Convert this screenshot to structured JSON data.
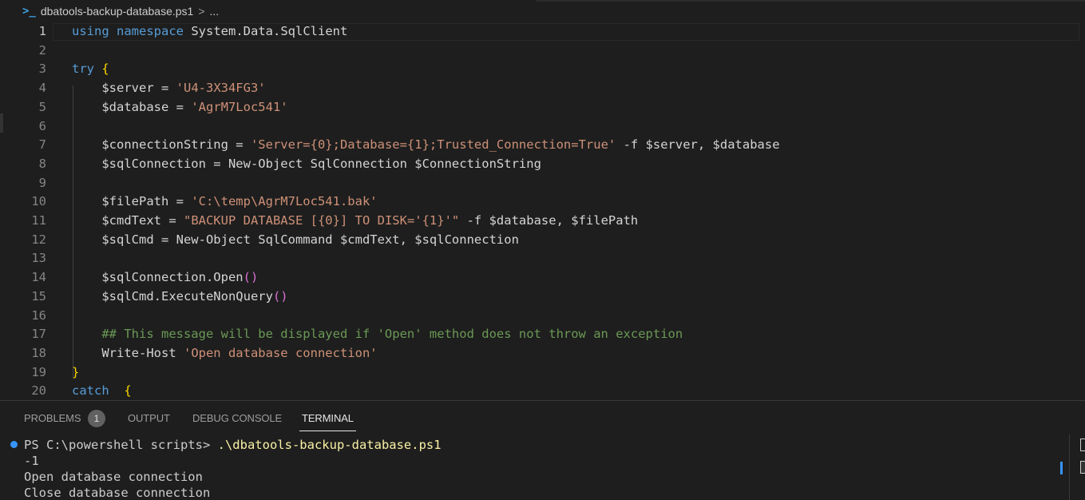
{
  "breadcrumb": {
    "icon": "powershell-icon",
    "filename": "dbatools-backup-database.ps1",
    "separator": ">",
    "more": "..."
  },
  "editor": {
    "lines": [
      {
        "num": "1",
        "tokens": [
          {
            "t": "kw",
            "v": "using"
          },
          {
            "t": "p",
            "v": " "
          },
          {
            "t": "kw",
            "v": "namespace"
          },
          {
            "t": "p",
            "v": " System.Data.SqlClient"
          }
        ]
      },
      {
        "num": "2",
        "tokens": []
      },
      {
        "num": "3",
        "tokens": [
          {
            "t": "kw",
            "v": "try"
          },
          {
            "t": "p",
            "v": " "
          },
          {
            "t": "brace",
            "v": "{"
          }
        ]
      },
      {
        "num": "4",
        "tokens": [
          {
            "t": "p",
            "v": "    $server = "
          },
          {
            "t": "str",
            "v": "'U4-3X34FG3'"
          }
        ]
      },
      {
        "num": "5",
        "tokens": [
          {
            "t": "p",
            "v": "    $database = "
          },
          {
            "t": "str",
            "v": "'AgrM7Loc541'"
          }
        ]
      },
      {
        "num": "6",
        "tokens": []
      },
      {
        "num": "7",
        "tokens": [
          {
            "t": "p",
            "v": "    $connectionString = "
          },
          {
            "t": "str",
            "v": "'Server={0};Database={1};Trusted_Connection=True'"
          },
          {
            "t": "p",
            "v": " -f $server, $database"
          }
        ]
      },
      {
        "num": "8",
        "tokens": [
          {
            "t": "p",
            "v": "    $sqlConnection = New-Object SqlConnection $ConnectionString"
          }
        ]
      },
      {
        "num": "9",
        "tokens": []
      },
      {
        "num": "10",
        "tokens": [
          {
            "t": "p",
            "v": "    $filePath = "
          },
          {
            "t": "str",
            "v": "'C:\\temp\\AgrM7Loc541.bak'"
          }
        ]
      },
      {
        "num": "11",
        "tokens": [
          {
            "t": "p",
            "v": "    $cmdText = "
          },
          {
            "t": "str",
            "v": "\"BACKUP DATABASE [{0}] TO DISK='{1}'\""
          },
          {
            "t": "p",
            "v": " -f $database, $filePath"
          }
        ]
      },
      {
        "num": "12",
        "tokens": [
          {
            "t": "p",
            "v": "    $sqlCmd = New-Object SqlCommand $cmdText, $sqlConnection"
          }
        ]
      },
      {
        "num": "13",
        "tokens": []
      },
      {
        "num": "14",
        "tokens": [
          {
            "t": "p",
            "v": "    $sqlConnection.Open"
          },
          {
            "t": "paren",
            "v": "()"
          }
        ]
      },
      {
        "num": "15",
        "tokens": [
          {
            "t": "p",
            "v": "    $sqlCmd.ExecuteNonQuery"
          },
          {
            "t": "paren",
            "v": "()"
          }
        ]
      },
      {
        "num": "16",
        "tokens": []
      },
      {
        "num": "17",
        "tokens": [
          {
            "t": "cmt",
            "v": "    ## This message will be displayed if 'Open' method does not throw an exception"
          }
        ]
      },
      {
        "num": "18",
        "tokens": [
          {
            "t": "p",
            "v": "    Write-Host "
          },
          {
            "t": "str",
            "v": "'Open database connection'"
          }
        ]
      },
      {
        "num": "19",
        "tokens": [
          {
            "t": "brace",
            "v": "}"
          }
        ]
      },
      {
        "num": "20",
        "tokens": [
          {
            "t": "kw",
            "v": "catch"
          },
          {
            "t": "p",
            "v": "  "
          },
          {
            "t": "brace",
            "v": "{"
          }
        ]
      }
    ]
  },
  "panel": {
    "tabs": [
      {
        "label": "PROBLEMS",
        "active": false
      },
      {
        "label": "OUTPUT",
        "active": false
      },
      {
        "label": "DEBUG CONSOLE",
        "active": false
      },
      {
        "label": "TERMINAL",
        "active": true
      }
    ],
    "problems_count": "1"
  },
  "terminal": {
    "prompt": "PS C:\\powershell scripts> ",
    "command": ".\\dbatools-backup-database.ps1",
    "output": [
      "-1",
      "Open database connection",
      "Close database connection"
    ]
  },
  "colors": {
    "background": "#1e1e1e",
    "keyword": "#569cd6",
    "string": "#ce9178",
    "comment": "#6a9955",
    "brace": "#ffd700",
    "paren": "#da70d6",
    "accent": "#3794ff"
  }
}
